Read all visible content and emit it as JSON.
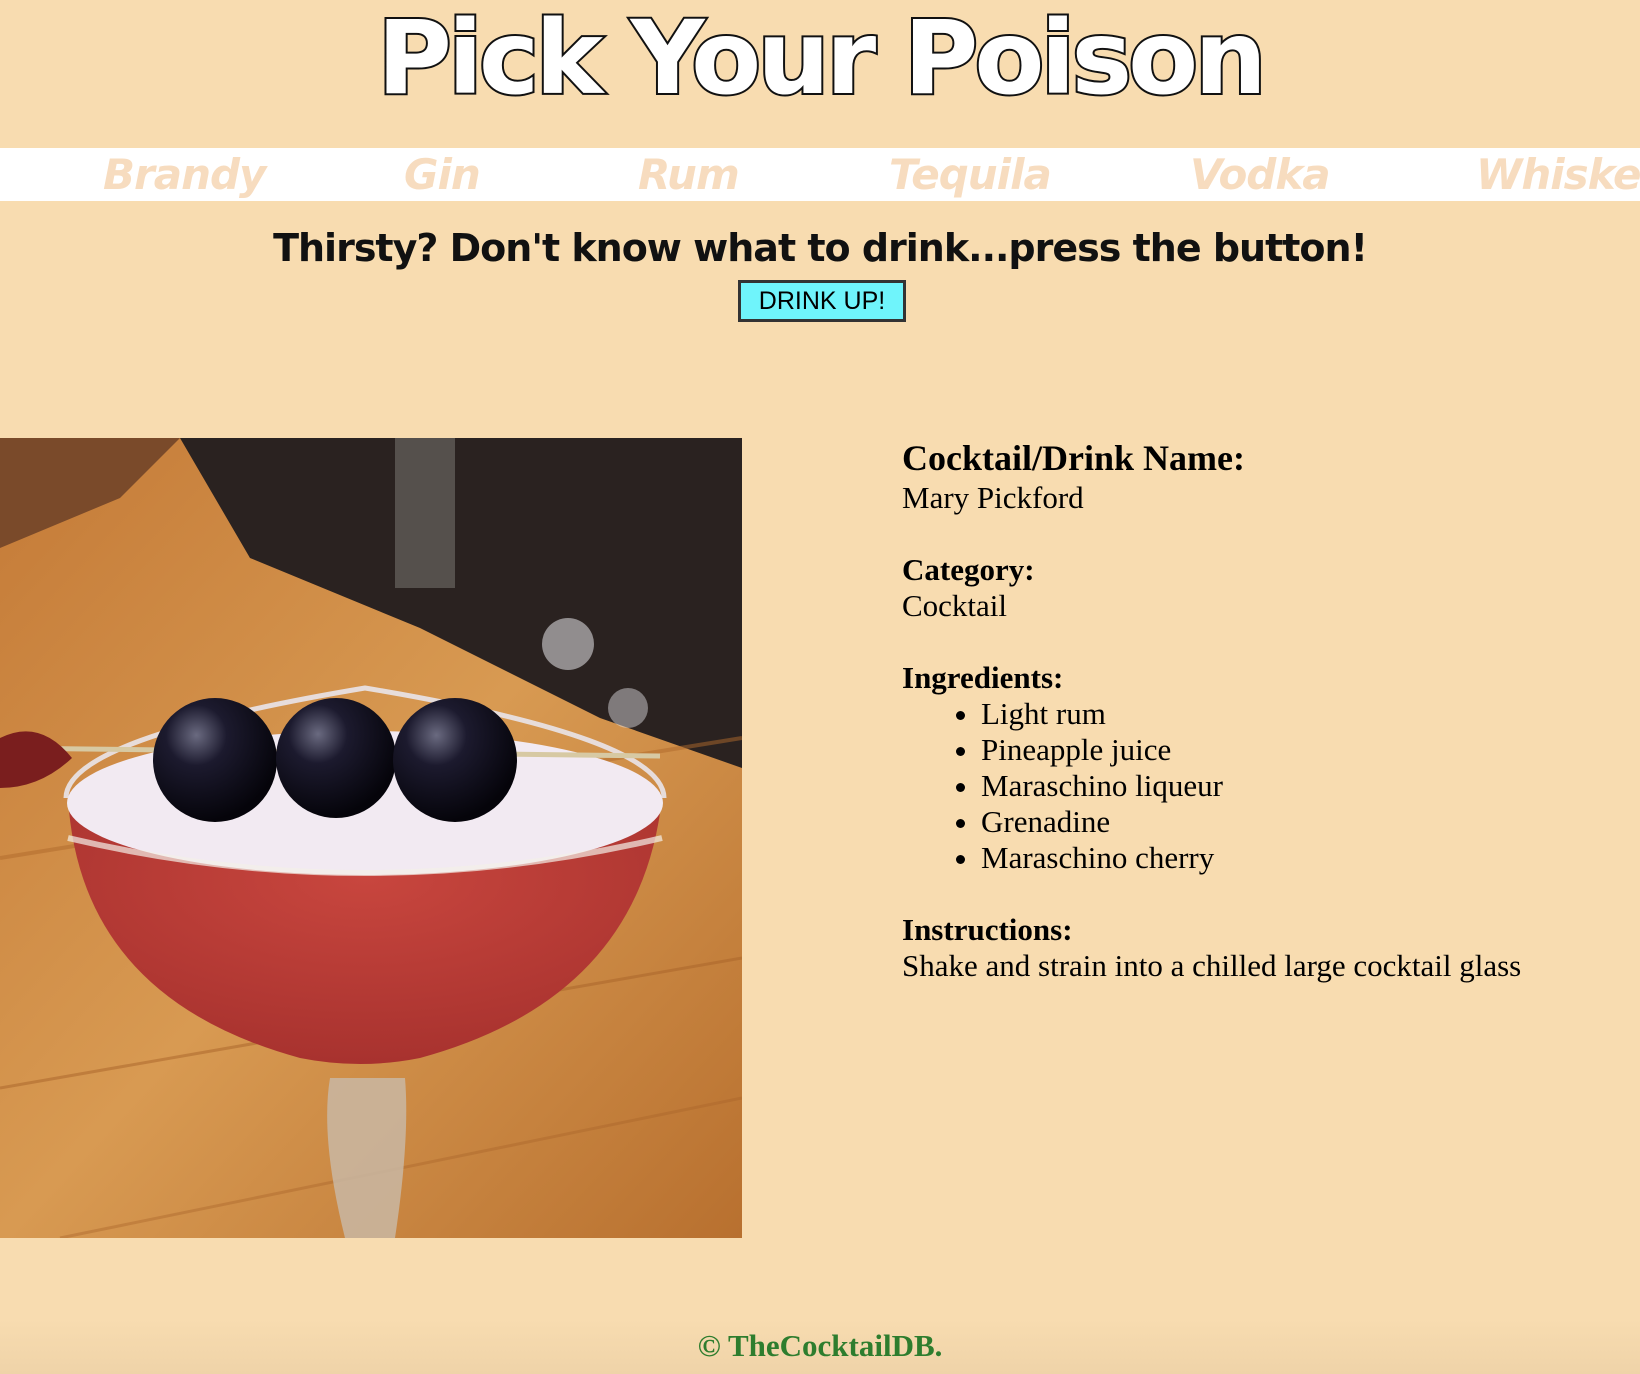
{
  "header": {
    "title": "Pick Your Poison"
  },
  "nav": {
    "items": [
      {
        "label": "Brandy"
      },
      {
        "label": "Gin"
      },
      {
        "label": "Rum"
      },
      {
        "label": "Tequila"
      },
      {
        "label": "Vodka"
      },
      {
        "label": "Whiskey"
      }
    ]
  },
  "prompt": {
    "tagline": "Thirsty? Don't know what to drink...press the button!",
    "button_label": "DRINK UP!"
  },
  "drink": {
    "image_alt": "cocktail photo",
    "name_label": "Cocktail/Drink Name:",
    "name": "Mary Pickford",
    "category_label": "Category:",
    "category": "Cocktail",
    "ingredients_label": "Ingredients:",
    "ingredients": [
      "Light rum",
      "Pineapple juice",
      "Maraschino liqueur",
      "Grenadine",
      "Maraschino cherry"
    ],
    "instructions_label": "Instructions:",
    "instructions": "Shake and strain into a chilled large cocktail glass"
  },
  "footer": {
    "text": "© TheCocktailDB."
  },
  "colors": {
    "background": "#f8dcb0",
    "nav_bar": "#ffffff",
    "nav_text": "#f7dcbf",
    "button": "#6ff4fb",
    "footer_text": "#2e7d2e"
  }
}
